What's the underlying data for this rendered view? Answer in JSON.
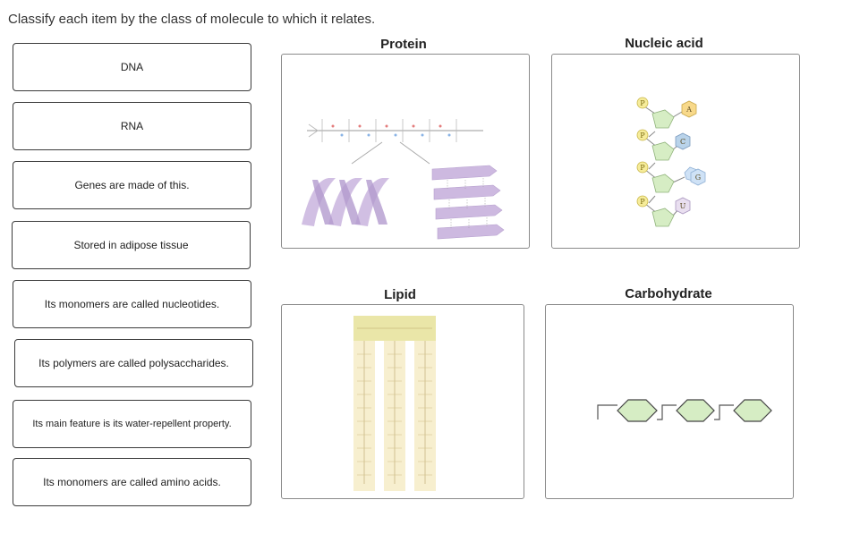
{
  "instruction": "Classify each item by the class of molecule to which it relates.",
  "items": [
    {
      "label": "DNA"
    },
    {
      "label": "RNA"
    },
    {
      "label": "Genes are made of this."
    },
    {
      "label": "Stored in adipose tissue"
    },
    {
      "label": "Its monomers are called nucleotides."
    },
    {
      "label": "Its polymers are called polysaccharides."
    },
    {
      "label": "Its main feature is its water-repellent property."
    },
    {
      "label": "Its monomers are called amino acids."
    }
  ],
  "zones": {
    "protein": {
      "label": "Protein"
    },
    "nucleic_acid": {
      "label": "Nucleic acid",
      "bases": [
        "A",
        "C",
        "G",
        "U"
      ],
      "phosphate": "P"
    },
    "lipid": {
      "label": "Lipid"
    },
    "carbohydrate": {
      "label": "Carbohydrate"
    }
  },
  "colors": {
    "protein_ribbon": "#c9b6df",
    "sugar_green": "#d6edc4",
    "phosphate_yellow": "#f6ec9a",
    "base_A": "#f8d98a",
    "base_C": "#b9d3ea",
    "base_G": "#cfe2f6",
    "base_U": "#e9dff0",
    "lipid_head": "#eae6a8",
    "lipid_tail": "#f7efcf"
  }
}
